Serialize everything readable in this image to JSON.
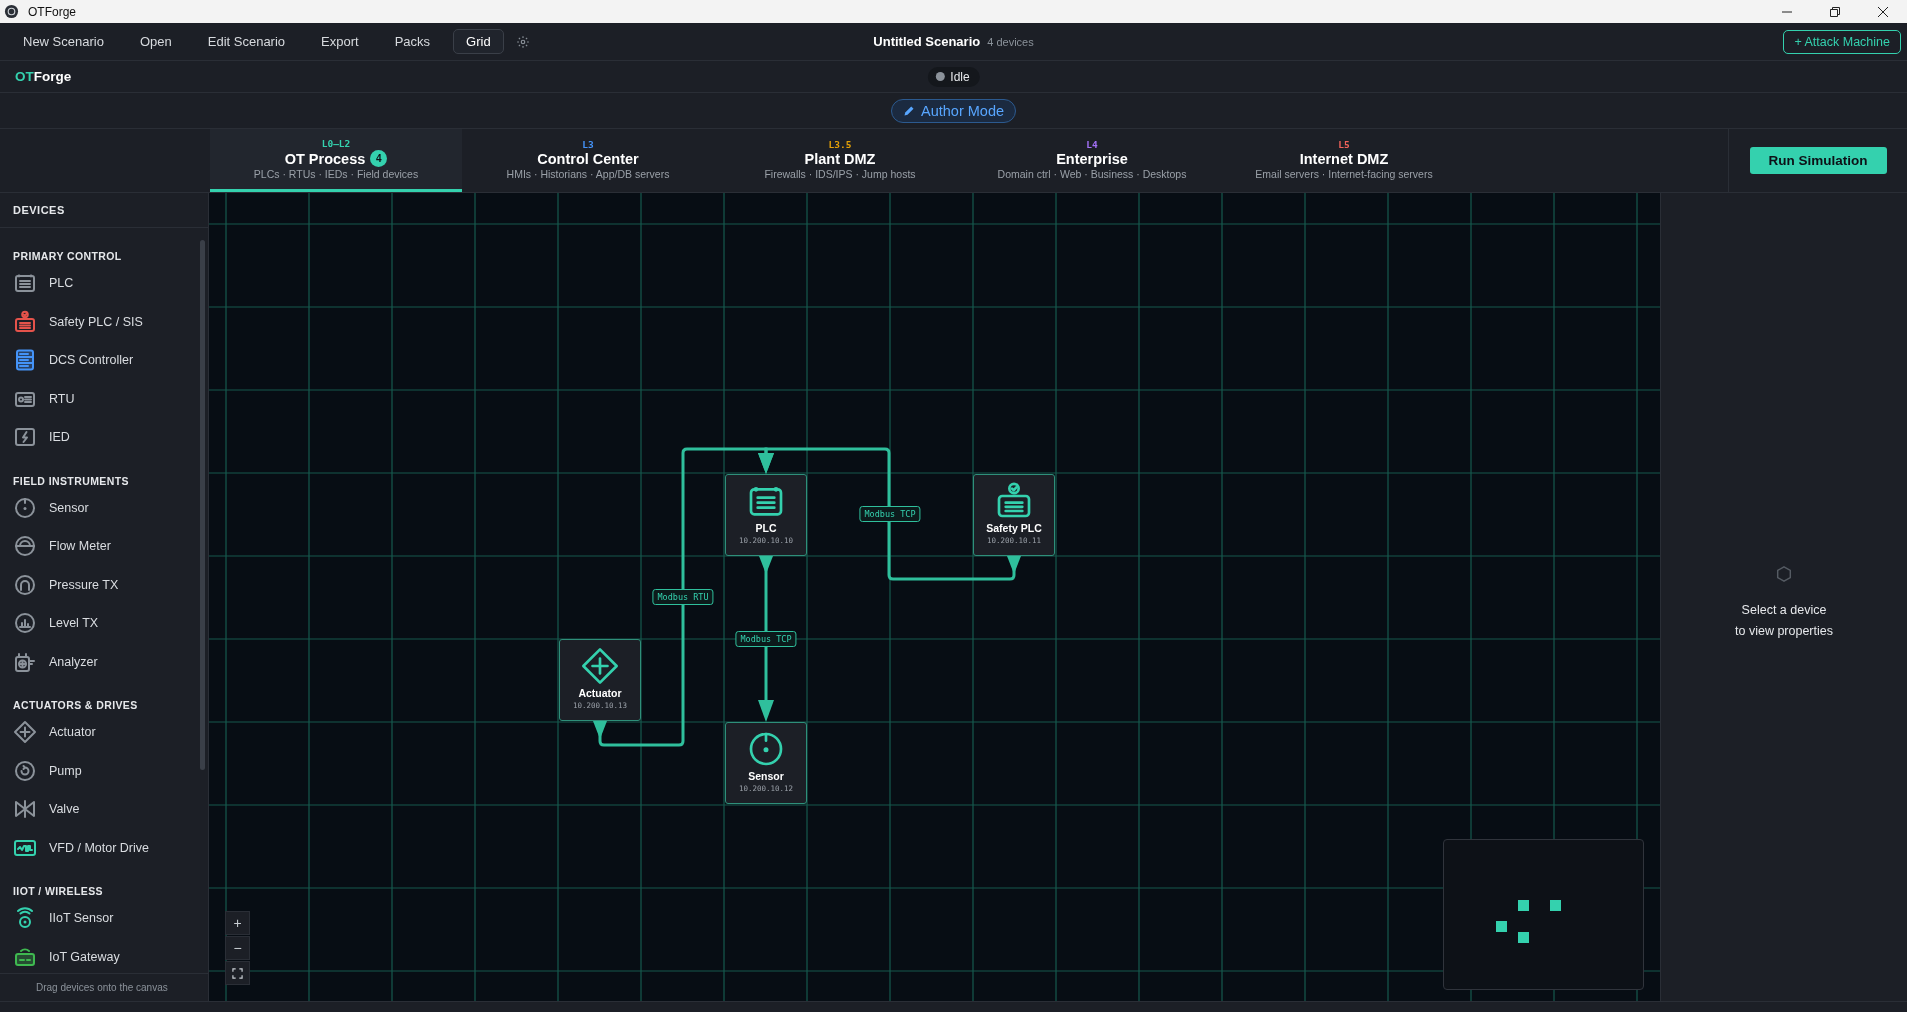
{
  "window": {
    "title": "OTForge"
  },
  "menu": [
    {
      "label": "New Scenario",
      "selected": false
    },
    {
      "label": "Open",
      "selected": false
    },
    {
      "label": "Edit Scenario",
      "selected": false
    },
    {
      "label": "Export",
      "selected": false
    },
    {
      "label": "Packs",
      "selected": false
    },
    {
      "label": "Grid",
      "selected": true
    }
  ],
  "scenario": {
    "title": "Untitled Scenario",
    "device_count": "4 devices"
  },
  "attack_button": "+ Attack Machine",
  "brand": {
    "accent": "OT",
    "rest": "Forge"
  },
  "status": {
    "label": "Idle",
    "running": false
  },
  "mode_button": "Author Mode",
  "layers": [
    {
      "code": "L0–L2",
      "name": "OT Process",
      "badge": "4",
      "description": "PLCs · RTUs · IEDs · Field devices",
      "color": "#34d1ae",
      "selected": true
    },
    {
      "code": "L3",
      "name": "Control Center",
      "description": "HMIs · Historians · App/DB servers",
      "color": "#4493f8",
      "selected": false
    },
    {
      "code": "L3.5",
      "name": "Plant DMZ",
      "description": "Firewalls · IDS/IPS · Jump hosts",
      "color": "#e3a008",
      "selected": false
    },
    {
      "code": "L4",
      "name": "Enterprise",
      "description": "Domain ctrl · Web · Business · Desktops",
      "color": "#a371f7",
      "selected": false
    },
    {
      "code": "L5",
      "name": "Internet DMZ",
      "description": "Email servers · Internet-facing servers",
      "color": "#f0625a",
      "selected": false
    }
  ],
  "run_button": "Run Simulation",
  "sidebar": {
    "title": "DEVICES",
    "groups": [
      {
        "title": "PRIMARY CONTROL",
        "items": [
          {
            "label": "PLC",
            "kind": "plc",
            "color": "#8b929a"
          },
          {
            "label": "Safety PLC / SIS",
            "kind": "safety-plc",
            "color": "#e5534b"
          },
          {
            "label": "DCS Controller",
            "kind": "dcs",
            "color": "#4493f8"
          },
          {
            "label": "RTU",
            "kind": "rtu",
            "color": "#8b929a"
          },
          {
            "label": "IED",
            "kind": "ied",
            "color": "#8b929a"
          }
        ]
      },
      {
        "title": "FIELD INSTRUMENTS",
        "items": [
          {
            "label": "Sensor",
            "kind": "sensor",
            "color": "#8b929a"
          },
          {
            "label": "Flow Meter",
            "kind": "flow-meter",
            "color": "#8b929a"
          },
          {
            "label": "Pressure TX",
            "kind": "pressure-tx",
            "color": "#8b929a"
          },
          {
            "label": "Level TX",
            "kind": "level-tx",
            "color": "#8b929a"
          },
          {
            "label": "Analyzer",
            "kind": "analyzer",
            "color": "#8b929a"
          }
        ]
      },
      {
        "title": "ACTUATORS & DRIVES",
        "items": [
          {
            "label": "Actuator",
            "kind": "actuator",
            "color": "#8b929a"
          },
          {
            "label": "Pump",
            "kind": "pump",
            "color": "#8b929a"
          },
          {
            "label": "Valve",
            "kind": "valve",
            "color": "#8b929a"
          },
          {
            "label": "VFD / Motor Drive",
            "kind": "vfd",
            "color": "#34d1ae"
          }
        ]
      },
      {
        "title": "IIOT / WIRELESS",
        "items": [
          {
            "label": "IIoT Sensor",
            "kind": "iiot-sensor",
            "color": "#34d1ae"
          },
          {
            "label": "IoT Gateway",
            "kind": "iot-gateway",
            "color": "#3fb950"
          }
        ]
      }
    ],
    "footer": "Drag devices onto the canvas"
  },
  "canvas": {
    "nodes": [
      {
        "name": "PLC",
        "ip": "10.200.10.10",
        "kind": "plc"
      },
      {
        "name": "Safety PLC",
        "ip": "10.200.10.11",
        "kind": "safety-plc"
      },
      {
        "name": "Actuator",
        "ip": "10.200.10.13",
        "kind": "actuator"
      },
      {
        "name": "Sensor",
        "ip": "10.200.10.12",
        "kind": "sensor"
      }
    ],
    "edges": [
      {
        "protocol": "Modbus RTU"
      },
      {
        "protocol": "Modbus TCP"
      },
      {
        "protocol": "Modbus TCP"
      }
    ],
    "zoom_in": "+",
    "zoom_out": "−"
  },
  "properties": {
    "hint": "Select a device\nto view properties"
  }
}
